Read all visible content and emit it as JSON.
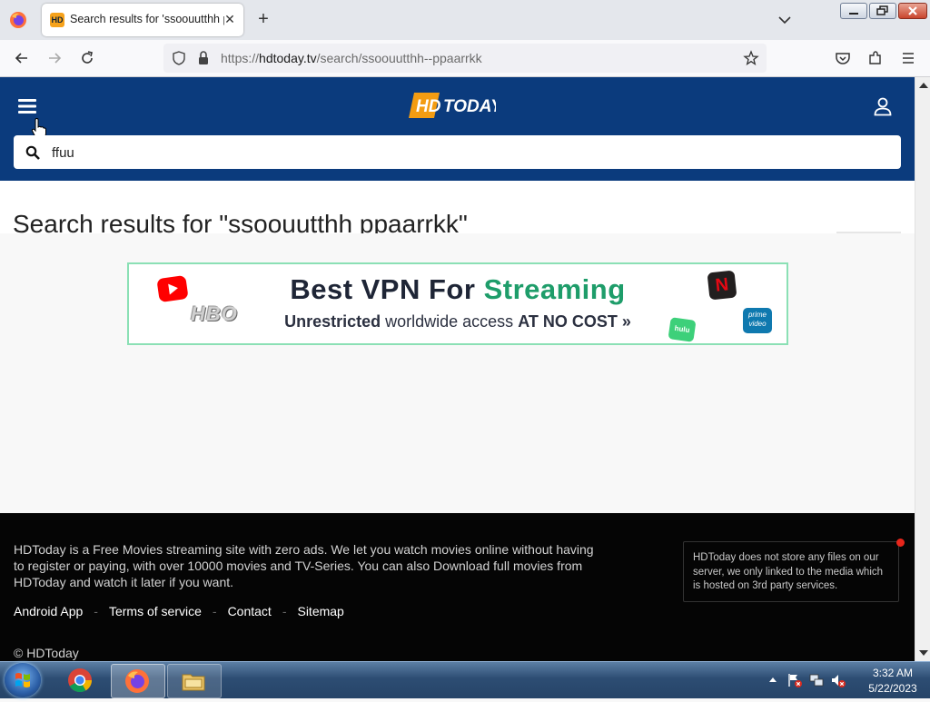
{
  "browser": {
    "tab": {
      "favicon_text": "HD",
      "title": "Search results for 'ssoouutthh p"
    },
    "url": {
      "prefix": "https://",
      "domain": "hdtoday.tv",
      "path": "/search/ssoouutthh--ppaarrkk"
    }
  },
  "site": {
    "logo_text": "HD TODAY",
    "search": {
      "value": "ffuu",
      "placeholder": ""
    },
    "results_title": "Search results for \"ssoouutthh ppaarrkk\""
  },
  "banner": {
    "headline": "Best VPN For",
    "headline_accent": "Streaming",
    "sub_normal": "worldwide access",
    "sub_lead": "Unrestricted",
    "sub_bold": "AT NO COST",
    "sub_arrow": "»",
    "brands": {
      "hbo": "HBO",
      "netflix": "N",
      "hulu": "hulu",
      "prime": "prime video"
    }
  },
  "footer": {
    "about": "HDToday is a Free Movies streaming site with zero ads. We let you watch movies online without having to register or paying, with over 10000 movies and TV-Series. You can also Download full movies from HDToday and watch it later if you want.",
    "links": [
      "Android App",
      "Terms of service",
      "Contact",
      "Sitemap"
    ],
    "separator": "-",
    "copyright": "© HDToday",
    "disclaimer": "HDToday does not store any files on our server, we only linked to the media which is hosted on 3rd party services."
  },
  "taskbar": {
    "time": "3:32 AM",
    "date": "5/22/2023"
  }
}
